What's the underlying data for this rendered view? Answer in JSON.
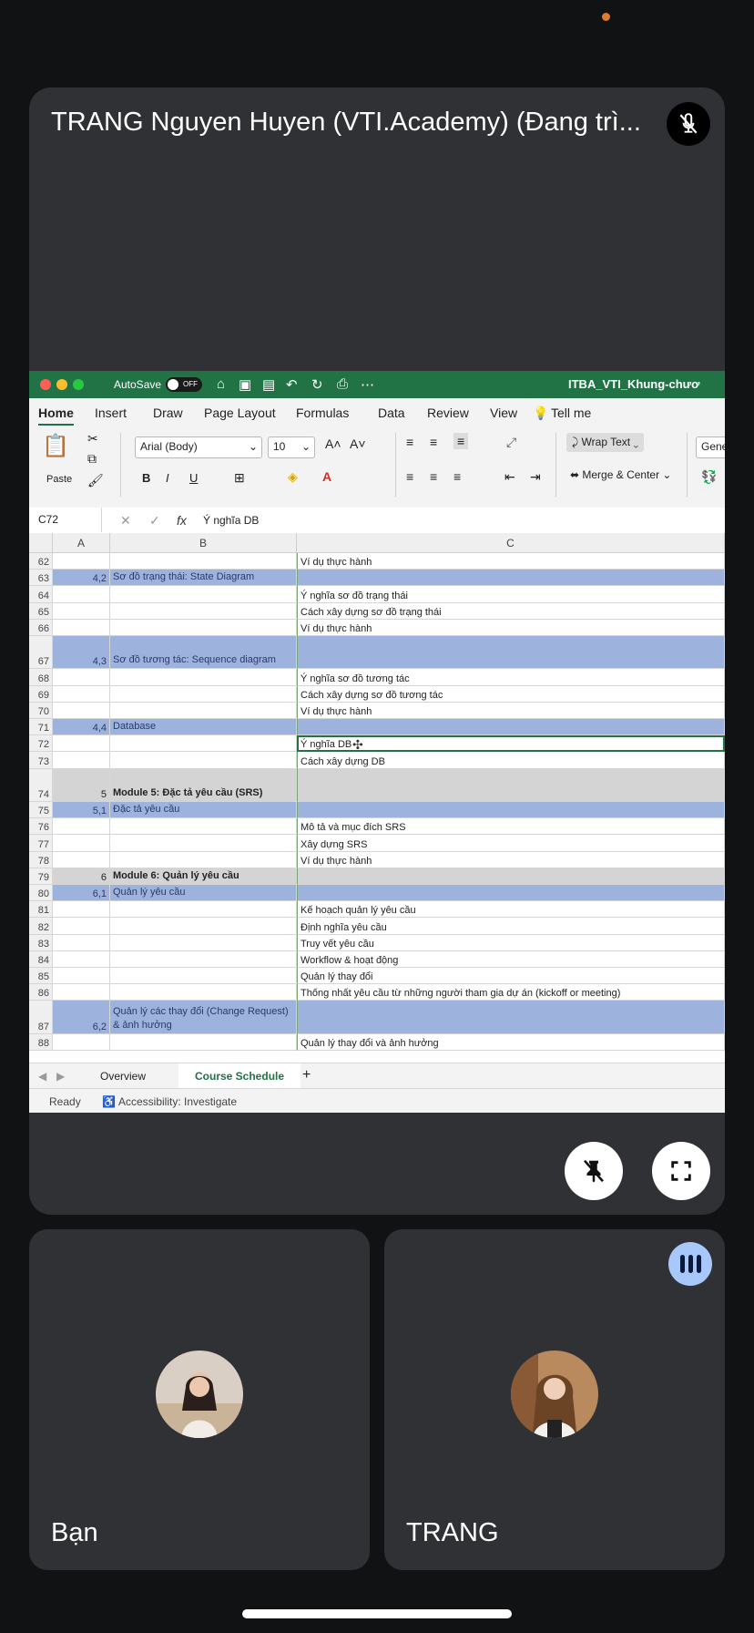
{
  "presenter": {
    "name": "TRANG Nguyen Huyen (VTI.Academy) (Đang trì..."
  },
  "excel": {
    "autosave_label": "AutoSave",
    "toggle_state": "OFF",
    "doc_title": "ITBA_VTI_Khung-chươ",
    "tabs": [
      "Home",
      "Insert",
      "Draw",
      "Page Layout",
      "Formulas",
      "Data",
      "Review",
      "View",
      "Tell me"
    ],
    "ribbon": {
      "paste": "Paste",
      "font_name": "Arial (Body)",
      "font_size": "10",
      "bold": "B",
      "italic": "I",
      "underline": "U",
      "wrap_text": "Wrap Text",
      "merge_center": "Merge & Center",
      "number_format": "General",
      "percent": "%",
      "grow_font": "A˄",
      "shrink_font": "A˅"
    },
    "name_box": "C72",
    "fx": "fx",
    "formula": "Ý nghĩa DB",
    "columns": [
      "A",
      "B",
      "C"
    ],
    "rows": [
      {
        "n": "62",
        "a": "",
        "b": "",
        "c": "Ví dụ thực hành",
        "style": ""
      },
      {
        "n": "63",
        "a": "4,2",
        "b": "Sơ đồ trạng thái: State Diagram",
        "c": "",
        "style": "blue"
      },
      {
        "n": "64",
        "a": "",
        "b": "",
        "c": "Ý nghĩa sơ đồ trạng thái",
        "style": ""
      },
      {
        "n": "65",
        "a": "",
        "b": "",
        "c": "Cách xây dựng sơ đồ trạng thái",
        "style": ""
      },
      {
        "n": "66",
        "a": "",
        "b": "",
        "c": "Ví dụ thực hành",
        "style": ""
      },
      {
        "n": "67",
        "a": "4,3",
        "b": "Sơ đồ tương tác: Sequence diagram",
        "c": "",
        "style": "blue"
      },
      {
        "n": "68",
        "a": "",
        "b": "",
        "c": "Ý nghĩa sơ đồ tương tác",
        "style": ""
      },
      {
        "n": "69",
        "a": "",
        "b": "",
        "c": "Cách xây dựng sơ đồ tương tác",
        "style": ""
      },
      {
        "n": "70",
        "a": "",
        "b": "",
        "c": "Ví dụ thực hành",
        "style": ""
      },
      {
        "n": "71",
        "a": "4,4",
        "b": "Database",
        "c": "",
        "style": "blue"
      },
      {
        "n": "72",
        "a": "",
        "b": "",
        "c": "Ý nghĩa DB",
        "style": "sel"
      },
      {
        "n": "73",
        "a": "",
        "b": "",
        "c": "Cách xây dựng DB",
        "style": ""
      },
      {
        "n": "74",
        "a": "5",
        "b": "Module 5: Đặc tả yêu cầu (SRS)",
        "c": "",
        "style": "gray"
      },
      {
        "n": "75",
        "a": "5,1",
        "b": "Đặc tả yêu cầu",
        "c": "",
        "style": "blue"
      },
      {
        "n": "76",
        "a": "",
        "b": "",
        "c": "Mô tả và mục đích SRS",
        "style": ""
      },
      {
        "n": "77",
        "a": "",
        "b": "",
        "c": "Xây dựng SRS",
        "style": ""
      },
      {
        "n": "78",
        "a": "",
        "b": "",
        "c": "Ví dụ thực hành",
        "style": ""
      },
      {
        "n": "79",
        "a": "6",
        "b": "Module 6: Quản lý yêu cầu",
        "c": "",
        "style": "gray"
      },
      {
        "n": "80",
        "a": "6,1",
        "b": "Quản lý yêu cầu",
        "c": "",
        "style": "blue"
      },
      {
        "n": "81",
        "a": "",
        "b": "",
        "c": "Kế hoạch quản lý yêu cầu",
        "style": ""
      },
      {
        "n": "82",
        "a": "",
        "b": "",
        "c": "Định nghĩa yêu cầu",
        "style": ""
      },
      {
        "n": "83",
        "a": "",
        "b": "",
        "c": "Truy vết yêu cầu",
        "style": ""
      },
      {
        "n": "84",
        "a": "",
        "b": "",
        "c": "Workflow & hoạt động",
        "style": ""
      },
      {
        "n": "85",
        "a": "",
        "b": "",
        "c": "Quản lý thay đổi",
        "style": ""
      },
      {
        "n": "86",
        "a": "",
        "b": "",
        "c": "Thống nhất yêu cầu từ những người tham gia dự án (kickoff or meeting)",
        "style": ""
      },
      {
        "n": "87",
        "a": "6,2",
        "b": "Quản lý các thay đổi (Change Request) & ảnh hưởng",
        "c": "",
        "style": "blue"
      },
      {
        "n": "88",
        "a": "",
        "b": "",
        "c": "Quản lý thay đổi và ảnh hưởng",
        "style": ""
      }
    ],
    "sheet_tabs": [
      "Overview",
      "Course Schedule"
    ],
    "add_sheet": "+",
    "status_ready": "Ready",
    "status_accessibility": "Accessibility: Investigate"
  },
  "participants": [
    {
      "name": "Bạn"
    },
    {
      "name": "TRANG"
    }
  ]
}
